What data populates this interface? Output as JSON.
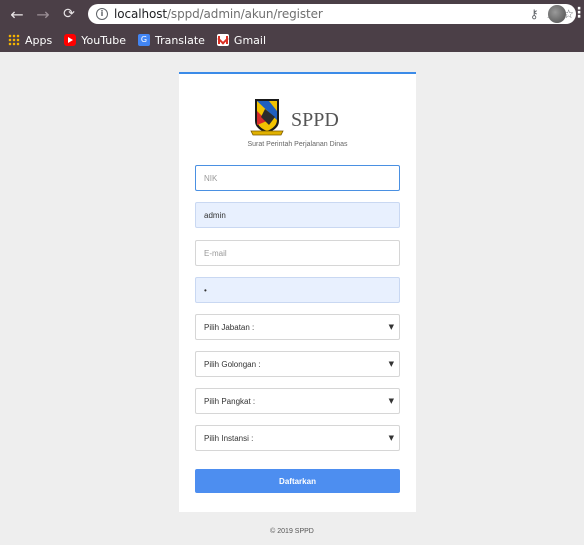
{
  "browser": {
    "url_host": "localhost",
    "url_path": "/sppd/admin/akun/register",
    "icons": [
      "back-icon",
      "forward-icon",
      "reload-icon",
      "info-icon",
      "key-icon",
      "zoom-icon",
      "star-icon",
      "profile-avatar",
      "menu-icon"
    ],
    "bookmarks": [
      {
        "label": "Apps",
        "icon": "apps-icon"
      },
      {
        "label": "YouTube",
        "icon": "youtube-icon"
      },
      {
        "label": "Translate",
        "icon": "translate-icon"
      },
      {
        "label": "Gmail",
        "icon": "gmail-icon"
      }
    ]
  },
  "card": {
    "brand": "SPPD",
    "subtitle": "Surat Perintah Perjalanan Dinas",
    "accent_color": "#3b8be8",
    "fields": {
      "nik_placeholder": "NIK",
      "username_value": "admin",
      "email_placeholder": "E-mail",
      "password_value": "•",
      "jabatan_placeholder": "Pilih Jabatan :",
      "golongan_placeholder": "Pilih Golongan :",
      "pangkat_placeholder": "Pilih Pangkat :",
      "instansi_placeholder": "Pilih Instansi :"
    },
    "submit_label": "Daftarkan",
    "button_color": "#4d8ef0"
  },
  "footer": {
    "text": "© 2019 SPPD"
  }
}
